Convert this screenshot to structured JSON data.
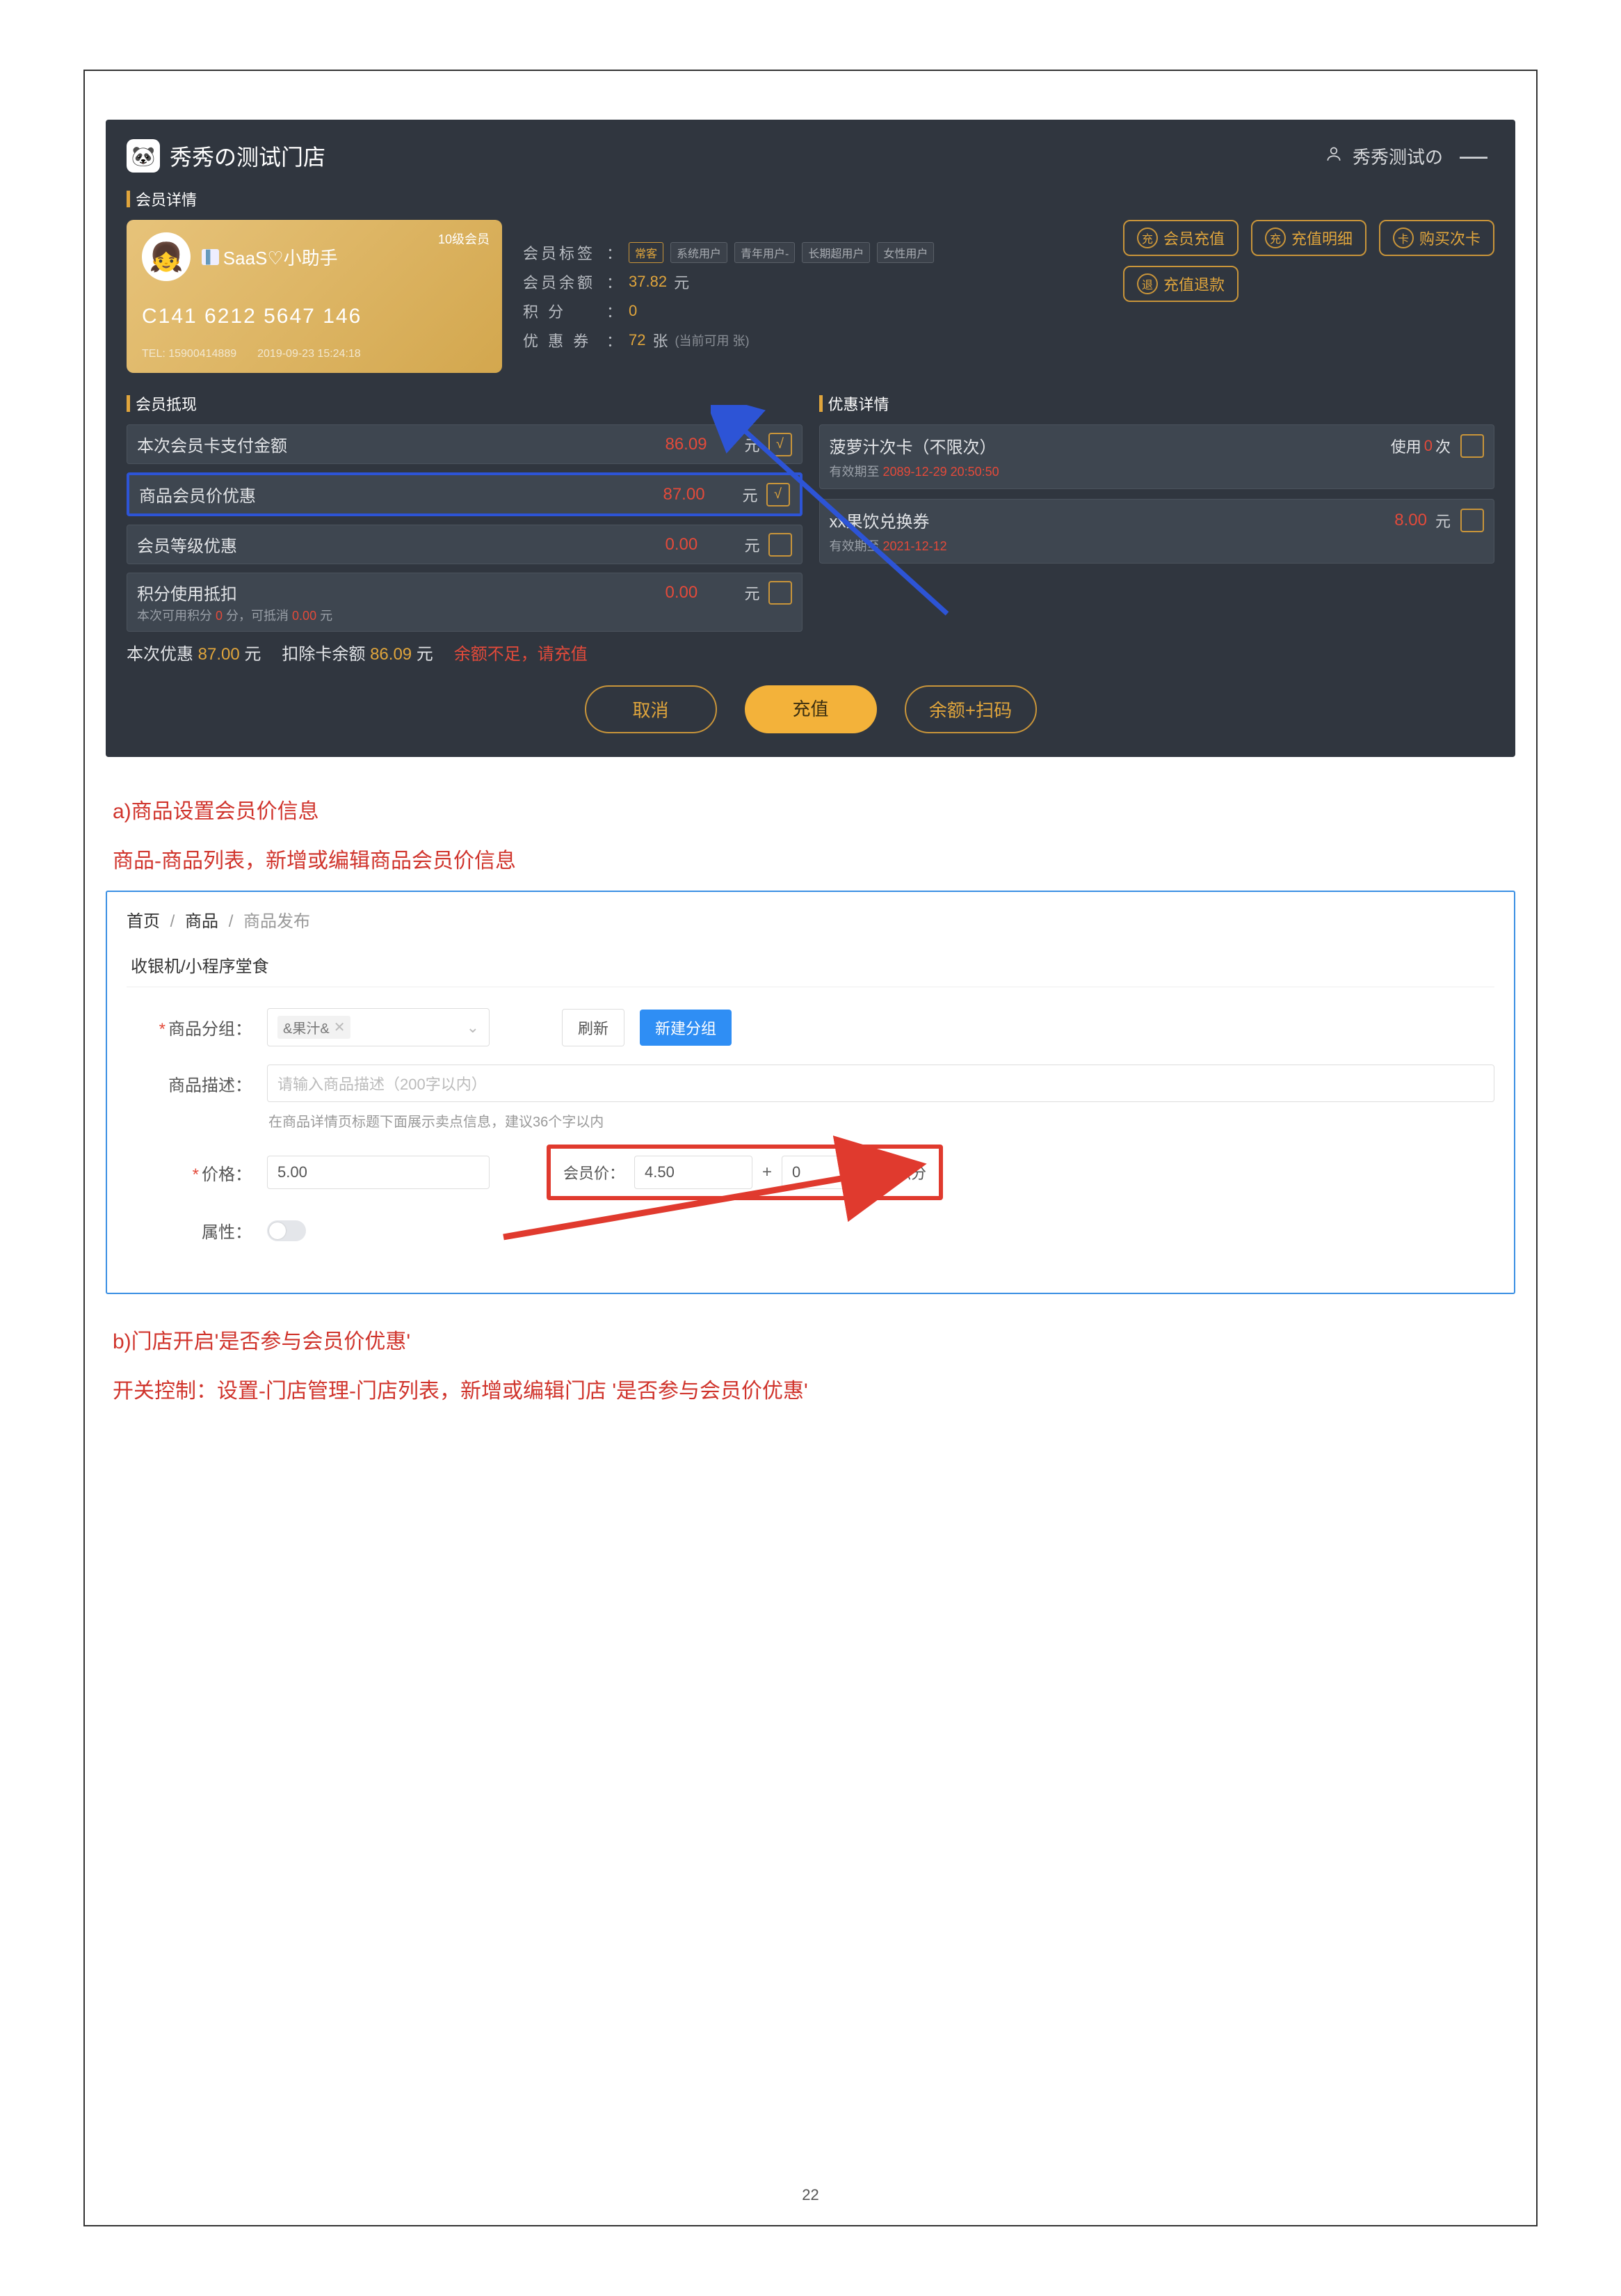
{
  "page_number": "22",
  "doc": {
    "a_heading": "a)商品设置会员价信息",
    "a_sub": "商品-商品列表，新增或编辑商品会员价信息",
    "b_heading": "b)门店开启'是否参与会员价优惠'",
    "b_sub": "开关控制：设置-门店管理-门店列表，新增或编辑门店 '是否参与会员价优惠'"
  },
  "pos": {
    "title": "秀秀の测试门店",
    "user": "秀秀测试の",
    "section_member_detail": "会员详情",
    "member": {
      "level": "10级会员",
      "name": "SaaS♡小助手",
      "card_no": "C141 6212 5647 146",
      "tel_label": "TEL: 15900414889",
      "reg_time": "2019-09-23 15:24:18"
    },
    "info": {
      "tags_label": "会员标签",
      "tags": [
        "常客",
        "系统用户",
        "青年用户-",
        "长期超用户",
        "女性用户"
      ],
      "balance_label": "会员余额",
      "balance_value": "37.82",
      "balance_unit": "元",
      "points_label": "积    分",
      "points_value": "0",
      "coupon_label": "优 惠 券",
      "coupon_value": "72",
      "coupon_unit": "张",
      "coupon_note": "(当前可用 张)"
    },
    "actions": {
      "recharge": "会员充值",
      "recharge_detail": "充值明细",
      "buy_card": "购买次卡",
      "refund": "充值退款",
      "icon_recharge": "充",
      "icon_refund": "退",
      "icon_card": "卡"
    },
    "deduct_title": "会员抵现",
    "coupon_title": "优惠详情",
    "rows": {
      "pay_amount_label": "本次会员卡支付金额",
      "pay_amount_value": "86.09",
      "pay_amount_unit": "元",
      "member_price_label": "商品会员价优惠",
      "member_price_value": "87.00",
      "member_price_unit": "元",
      "level_discount_label": "会员等级优惠",
      "level_discount_value": "0.00",
      "level_discount_unit": "元",
      "points_deduct_label": "积分使用抵扣",
      "points_deduct_value": "0.00",
      "points_deduct_unit": "元",
      "points_deduct_sub_pref": "本次可用积分 ",
      "points_deduct_sub_a": "0",
      "points_deduct_sub_mid": " 分，可抵消 ",
      "points_deduct_sub_b": "0.00",
      "points_deduct_sub_suf": " 元"
    },
    "coupons": {
      "c1_title": "菠萝汁次卡（不限次）",
      "c1_use_pref": "使用 ",
      "c1_use_val": "0",
      "c1_use_suf": " 次",
      "c1_sub_label": "有效期至 ",
      "c1_sub_val": "2089-12-29 20:50:50",
      "c2_title": "xx果饮兑换券",
      "c2_amt": "8.00",
      "c2_amt_unit": "元",
      "c2_sub_label": "有效期至 ",
      "c2_sub_val": "2021-12-12"
    },
    "summary": {
      "disc_label": "本次优惠 ",
      "disc_val": "87.00",
      "disc_unit": " 元",
      "deduct_label": "扣除卡余额 ",
      "deduct_val": "86.09",
      "deduct_unit": " 元",
      "warn": "余额不足，请充值"
    },
    "buttons": {
      "cancel": "取消",
      "recharge": "充值",
      "scan": "余额+扫码"
    }
  },
  "form": {
    "bc_home": "首页",
    "bc_prod": "商品",
    "bc_release": "商品发布",
    "tab": "收银机/小程序堂食",
    "group_label": "商品分组：",
    "group_value": "&果汁&",
    "refresh": "刷新",
    "new_group": "新建分组",
    "desc_label": "商品描述：",
    "desc_placeholder": "请输入商品描述（200字以内）",
    "desc_hint": "在商品详情页标题下面展示卖点信息，建议36个字以内",
    "price_label": "价格：",
    "price_value": "5.00",
    "member_price_label": "会员价：",
    "member_price_value": "4.50",
    "points_value": "0",
    "points_unit": "积分",
    "attr_label": "属性："
  }
}
